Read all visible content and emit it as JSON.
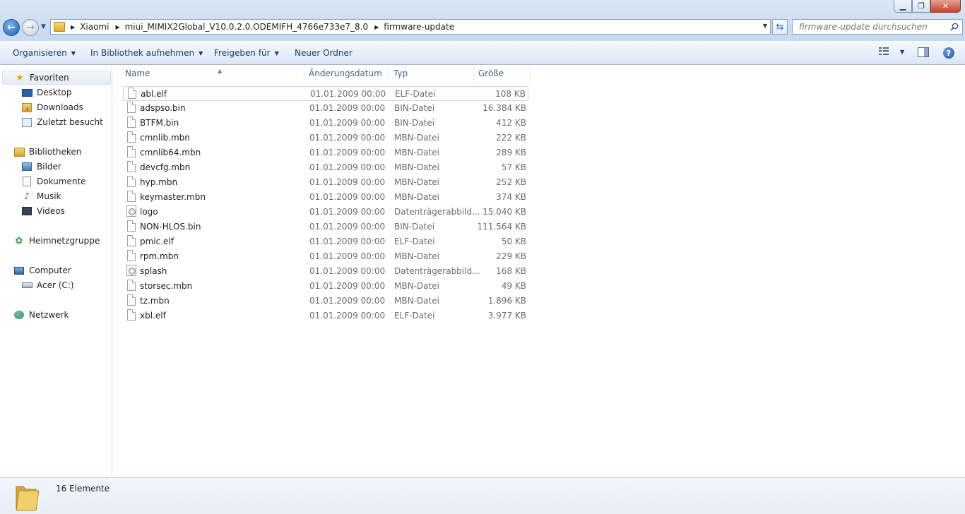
{
  "window": {
    "minimize": "▁",
    "maximize": "❐",
    "close": "✕"
  },
  "breadcrumb": [
    "Xiaomi",
    "miui_MIMIX2Global_V10.0.2.0.ODEMIFH_4766e733e7_8.0",
    "firmware-update"
  ],
  "search": {
    "placeholder": "firmware-update durchsuchen"
  },
  "toolbar": {
    "organize": "Organisieren",
    "include_library": "In Bibliothek aufnehmen",
    "share": "Freigeben für",
    "new_folder": "Neuer Ordner"
  },
  "sidebar": {
    "favorites": {
      "label": "Favoriten",
      "items": [
        "Desktop",
        "Downloads",
        "Zuletzt besucht"
      ]
    },
    "libraries": {
      "label": "Bibliotheken",
      "items": [
        "Bilder",
        "Dokumente",
        "Musik",
        "Videos"
      ]
    },
    "homegroup": {
      "label": "Heimnetzgruppe"
    },
    "computer": {
      "label": "Computer",
      "items": [
        "Acer (C:)"
      ]
    },
    "network": {
      "label": "Netzwerk"
    }
  },
  "columns": {
    "name": "Name",
    "date": "Änderungsdatum",
    "type": "Typ",
    "size": "Größe"
  },
  "files": [
    {
      "name": "abl.elf",
      "date": "01.01.2009 00:00",
      "type": "ELF-Datei",
      "size": "108 KB",
      "icon": "file-icon"
    },
    {
      "name": "adspso.bin",
      "date": "01.01.2009 00:00",
      "type": "BIN-Datei",
      "size": "16.384 KB",
      "icon": "file-icon"
    },
    {
      "name": "BTFM.bin",
      "date": "01.01.2009 00:00",
      "type": "BIN-Datei",
      "size": "412 KB",
      "icon": "file-icon"
    },
    {
      "name": "cmnlib.mbn",
      "date": "01.01.2009 00:00",
      "type": "MBN-Datei",
      "size": "222 KB",
      "icon": "file-icon"
    },
    {
      "name": "cmnlib64.mbn",
      "date": "01.01.2009 00:00",
      "type": "MBN-Datei",
      "size": "289 KB",
      "icon": "file-icon"
    },
    {
      "name": "devcfg.mbn",
      "date": "01.01.2009 00:00",
      "type": "MBN-Datei",
      "size": "57 KB",
      "icon": "file-icon"
    },
    {
      "name": "hyp.mbn",
      "date": "01.01.2009 00:00",
      "type": "MBN-Datei",
      "size": "252 KB",
      "icon": "file-icon"
    },
    {
      "name": "keymaster.mbn",
      "date": "01.01.2009 00:00",
      "type": "MBN-Datei",
      "size": "374 KB",
      "icon": "file-icon"
    },
    {
      "name": "logo",
      "date": "01.01.2009 00:00",
      "type": "Datenträgerabbild...",
      "size": "15.040 KB",
      "icon": "disc-image-icon"
    },
    {
      "name": "NON-HLOS.bin",
      "date": "01.01.2009 00:00",
      "type": "BIN-Datei",
      "size": "111.564 KB",
      "icon": "file-icon"
    },
    {
      "name": "pmic.elf",
      "date": "01.01.2009 00:00",
      "type": "ELF-Datei",
      "size": "50 KB",
      "icon": "file-icon"
    },
    {
      "name": "rpm.mbn",
      "date": "01.01.2009 00:00",
      "type": "MBN-Datei",
      "size": "229 KB",
      "icon": "file-icon"
    },
    {
      "name": "splash",
      "date": "01.01.2009 00:00",
      "type": "Datenträgerabbild...",
      "size": "168 KB",
      "icon": "disc-image-icon"
    },
    {
      "name": "storsec.mbn",
      "date": "01.01.2009 00:00",
      "type": "MBN-Datei",
      "size": "49 KB",
      "icon": "file-icon"
    },
    {
      "name": "tz.mbn",
      "date": "01.01.2009 00:00",
      "type": "MBN-Datei",
      "size": "1.896 KB",
      "icon": "file-icon"
    },
    {
      "name": "xbl.elf",
      "date": "01.01.2009 00:00",
      "type": "ELF-Datei",
      "size": "3.977 KB",
      "icon": "file-icon"
    }
  ],
  "status": {
    "count": "16 Elemente"
  },
  "colors": {
    "accent": "#1e5fb0",
    "cmd_text": "#1e395b",
    "secondary_text": "#6d6d6d"
  }
}
